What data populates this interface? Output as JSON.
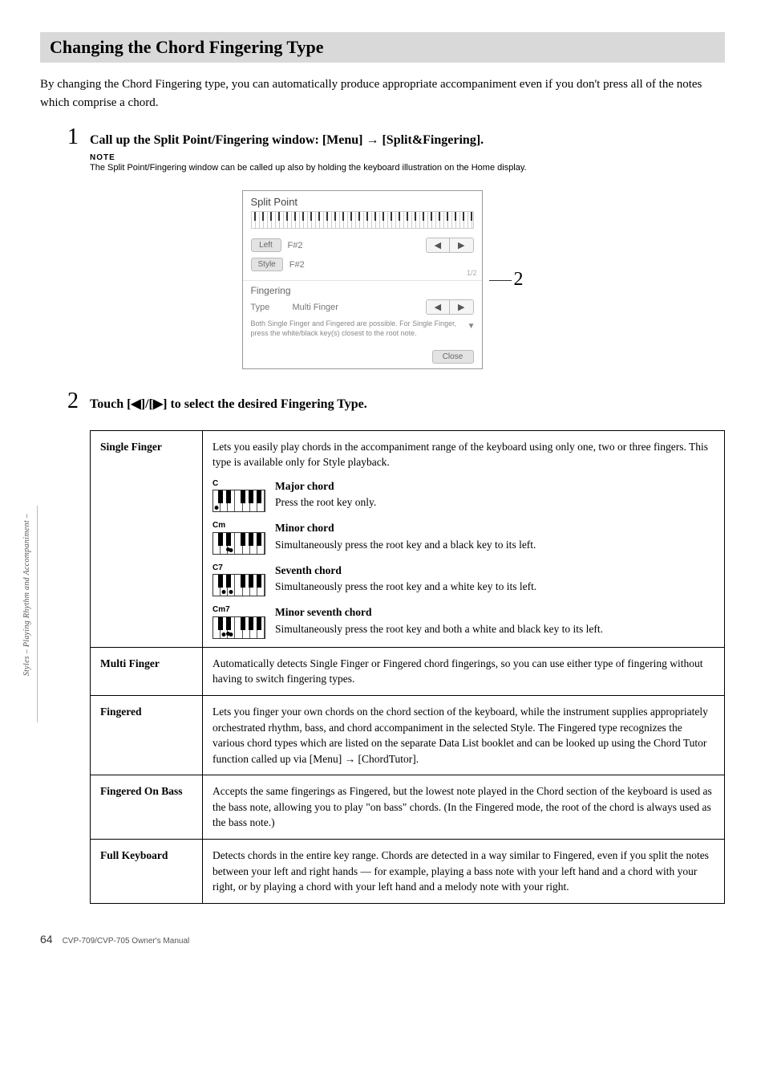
{
  "header": {
    "title": "Changing the Chord Fingering Type"
  },
  "intro": "By changing the Chord Fingering type, you can automatically produce appropriate accompaniment even if you don't press all of the notes which comprise a chord.",
  "steps": {
    "s1": {
      "num": "1",
      "title": "Call up the Split Point/Fingering window: [Menu] → [Split&Fingering].",
      "note_label": "NOTE",
      "note_text": "The Split Point/Fingering window can be called up also by holding the keyboard illustration on the Home display."
    },
    "s2": {
      "num": "2",
      "title": "Touch [◀]/[▶] to select the desired Fingering Type."
    }
  },
  "screenshot": {
    "title": "Split Point",
    "left_label": "Left",
    "left_val": "F#2",
    "style_label": "Style",
    "style_val": "F#2",
    "arrow_l": "◀",
    "arrow_r": "▶",
    "frac": "1/2",
    "sub": "Fingering",
    "type_label": "Type",
    "type_val": "Multi Finger",
    "desc": "Both Single Finger and Fingered are possible. For Single Finger, press the white/black key(s) closest to the root note.",
    "close": "Close",
    "marker": "2"
  },
  "table": {
    "r0": {
      "name": "Single Finger",
      "intro": "Lets you easily play chords in the accompaniment range of the keyboard using only one, two or three fingers. This type is available only for Style playback.",
      "c1": {
        "label": "C",
        "title": "Major chord",
        "desc": "Press the root key only."
      },
      "c2": {
        "label": "Cm",
        "title": "Minor chord",
        "desc": "Simultaneously press the root key and a black key to its left."
      },
      "c3": {
        "label": "C7",
        "title": "Seventh chord",
        "desc": "Simultaneously press the root key and a white key to its left."
      },
      "c4": {
        "label": "Cm7",
        "title": "Minor seventh chord",
        "desc": "Simultaneously press the root key and both a white and black key to its left."
      }
    },
    "r1": {
      "name": "Multi Finger",
      "desc": "Automatically detects Single Finger or Fingered chord fingerings, so you can use either type of fingering without having to switch fingering types."
    },
    "r2": {
      "name": "Fingered",
      "desc": "Lets you finger your own chords on the chord section of the keyboard, while the instrument supplies appropriately orchestrated rhythm, bass, and chord accompaniment in the selected Style. The Fingered type recognizes the various chord types which are listed on the separate Data List booklet and can be looked up using the Chord Tutor function called up via [Menu] → [ChordTutor]."
    },
    "r3": {
      "name": "Fingered On Bass",
      "desc": "Accepts the same fingerings as Fingered, but the lowest note played in the Chord section of the keyboard is used as the bass note, allowing you to play \"on bass\" chords. (In the Fingered mode, the root of the chord is always used as the bass note.)"
    },
    "r4": {
      "name": "Full Keyboard",
      "desc": "Detects chords in the entire key range. Chords are detected in a way similar to Fingered, even if you split the notes between your left and right hands — for example, playing a bass note with your left hand and a chord with your right, or by playing a chord with your left hand and a melody note with your right."
    }
  },
  "side": "Styles – Playing Rhythm and Accompaniment –",
  "footer": {
    "page": "64",
    "ref": "CVP-709/CVP-705 Owner's Manual"
  }
}
